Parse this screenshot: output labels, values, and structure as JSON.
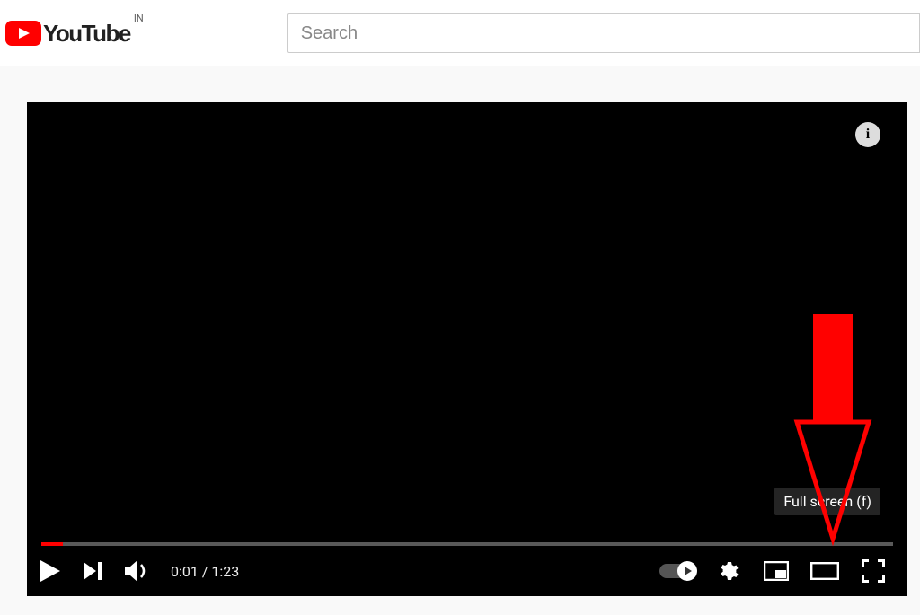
{
  "header": {
    "brand": "YouTube",
    "country": "IN",
    "search_placeholder": "Search"
  },
  "player": {
    "info_badge": "i",
    "tooltip_text": "Full screen (f)",
    "current_time": "0:01",
    "duration": "1:23",
    "time_separator": " / "
  }
}
